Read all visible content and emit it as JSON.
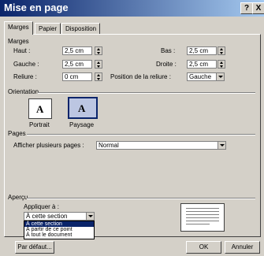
{
  "window": {
    "title": "Mise en page",
    "help_label": "?",
    "close_label": "X"
  },
  "tabs": [
    {
      "label": "Marges"
    },
    {
      "label": "Papier"
    },
    {
      "label": "Disposition"
    }
  ],
  "margins": {
    "section_label": "Marges",
    "top": {
      "label": "Haut :",
      "value": "2,5 cm"
    },
    "bottom": {
      "label": "Bas :",
      "value": "2,5 cm"
    },
    "left": {
      "label": "Gauche :",
      "value": "2,5 cm"
    },
    "right": {
      "label": "Droite :",
      "value": "2,5 cm"
    },
    "gutter": {
      "label": "Reliure :",
      "value": "0 cm"
    },
    "gutter_position": {
      "label": "Position de la reliure :",
      "value": "Gauche"
    }
  },
  "orientation": {
    "section_label": "Orientation",
    "portrait_label": "Portrait",
    "landscape_label": "Paysage",
    "icon_letter": "A",
    "selected": "Paysage"
  },
  "pages": {
    "section_label": "Pages",
    "multiple_label": "Afficher plusieurs pages :",
    "multiple_value": "Normal"
  },
  "preview": {
    "section_label": "Aperçu",
    "apply_label": "Appliquer à :",
    "apply_value": "À cette section",
    "options": [
      "À cette section",
      "À partir de ce point",
      "À tout le document"
    ],
    "highlighted_index": 0
  },
  "buttons": {
    "default_label": "Par défaut...",
    "ok_label": "OK",
    "cancel_label": "Annuler"
  },
  "colors": {
    "titlebar": "#0a246a",
    "dialog": "#d4d0c8",
    "selection": "#0a246a"
  }
}
